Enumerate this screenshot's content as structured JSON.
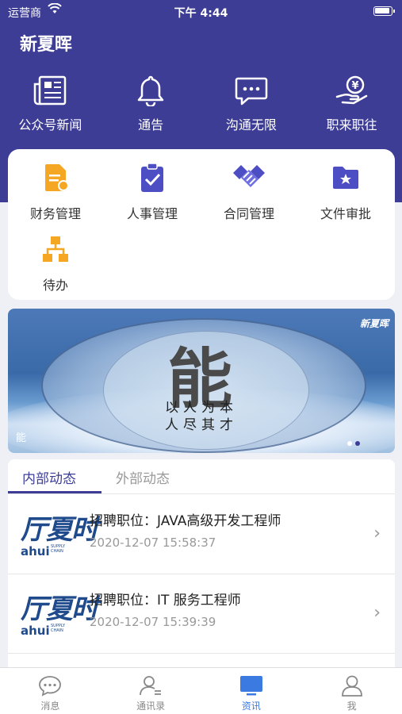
{
  "status_bar": {
    "carrier": "运营商",
    "time": "下午 4:44"
  },
  "app": {
    "title": "新夏晖"
  },
  "top_nav": [
    {
      "label": "公众号新闻",
      "icon": "newspaper-icon"
    },
    {
      "label": "通告",
      "icon": "bell-icon"
    },
    {
      "label": "沟通无限",
      "icon": "chat-icon"
    },
    {
      "label": "职来职往",
      "icon": "yen-hand-icon"
    }
  ],
  "grid": [
    {
      "label": "财务管理",
      "icon": "finance-doc-icon",
      "color": "#f5a623"
    },
    {
      "label": "人事管理",
      "icon": "clipboard-check-icon",
      "color": "#4d4dc4"
    },
    {
      "label": "合同管理",
      "icon": "handshake-icon",
      "color": "#4d4dc4"
    },
    {
      "label": "文件审批",
      "icon": "folder-star-icon",
      "color": "#4d4dc4"
    },
    {
      "label": "待办",
      "icon": "org-chart-icon",
      "color": "#f5a623"
    }
  ],
  "banner": {
    "big_text": "能",
    "line1": "以人为本",
    "line2": "人尽其才",
    "brand": "新夏晖",
    "caption": "能"
  },
  "news_tabs": {
    "active": "内部动态",
    "inactive": "外部动态"
  },
  "news": [
    {
      "title": "招聘职位：JAVA高级开发工程师",
      "date": "2020-12-07 15:58:37",
      "logo_main": "厅夏时",
      "logo_sub": "ahui",
      "logo_tiny": "SUPPLY CHAIN"
    },
    {
      "title": "招聘职位：IT 服务工程师",
      "date": "2020-12-07 15:39:39",
      "logo_main": "厅夏时",
      "logo_sub": "ahui",
      "logo_tiny": "SUPPLY CHAIN"
    }
  ],
  "tab_bar": [
    {
      "label": "消息",
      "icon": "message-icon",
      "active": false
    },
    {
      "label": "通讯录",
      "icon": "contacts-icon",
      "active": false
    },
    {
      "label": "资讯",
      "icon": "monitor-icon",
      "active": true
    },
    {
      "label": "我",
      "icon": "person-icon",
      "active": false
    }
  ],
  "colors": {
    "primary": "#3d3d96",
    "accent_orange": "#f5a623",
    "accent_blue": "#4d4dc4",
    "tab_active": "#3b7ae0",
    "tab_inactive": "#888888"
  }
}
